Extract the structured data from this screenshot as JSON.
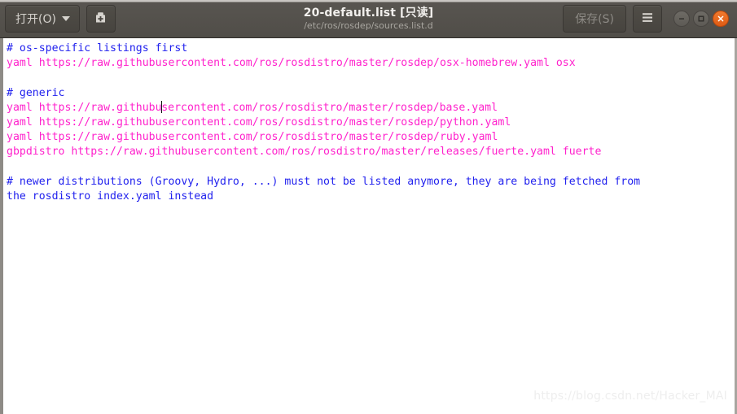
{
  "window": {
    "title": "20-default.list [只读]",
    "subtitle": "/etc/ros/rosdep/sources.list.d"
  },
  "titlebar": {
    "open_label": "打开(O)",
    "open_icon": "chevron-down-icon",
    "newdoc_icon": "save-as-icon",
    "save_label": "保存(S)",
    "menu_icon": "hamburger-menu-icon",
    "minimize_icon": "minimize-icon",
    "maximize_icon": "maximize-icon",
    "close_icon": "close-icon",
    "colors": {
      "titlebar_bg": "#504d48",
      "title_text": "#f1efec",
      "subtitle_text": "#a9a6a0",
      "button_bg": "#4a4742",
      "save_disabled_text": "#8d8a85",
      "close_button": "#e8620f"
    }
  },
  "editor": {
    "colors": {
      "background": "#ffffff",
      "comment": "#2222ee",
      "url_line": "#ff22cc"
    },
    "cursor": {
      "line": 5,
      "column_after": "yaml https://raw.githubu"
    },
    "lines": [
      {
        "text": "# os-specific listings first",
        "type": "comment"
      },
      {
        "text": "yaml https://raw.githubusercontent.com/ros/rosdistro/master/rosdep/osx-homebrew.yaml osx",
        "type": "url"
      },
      {
        "text": "",
        "type": "blank"
      },
      {
        "text": "# generic",
        "type": "comment"
      },
      {
        "text": "yaml https://raw.githubusercontent.com/ros/rosdistro/master/rosdep/base.yaml",
        "type": "url",
        "cursor_at": 24
      },
      {
        "text": "yaml https://raw.githubusercontent.com/ros/rosdistro/master/rosdep/python.yaml",
        "type": "url"
      },
      {
        "text": "yaml https://raw.githubusercontent.com/ros/rosdistro/master/rosdep/ruby.yaml",
        "type": "url"
      },
      {
        "text": "gbpdistro https://raw.githubusercontent.com/ros/rosdistro/master/releases/fuerte.yaml fuerte",
        "type": "url"
      },
      {
        "text": "",
        "type": "blank"
      },
      {
        "text": "# newer distributions (Groovy, Hydro, ...) must not be listed anymore, they are being fetched from",
        "type": "comment"
      },
      {
        "text": "the rosdistro index.yaml instead",
        "type": "comment"
      }
    ]
  },
  "watermark": {
    "text": "https://blog.csdn.net/Hacker_MAI"
  }
}
